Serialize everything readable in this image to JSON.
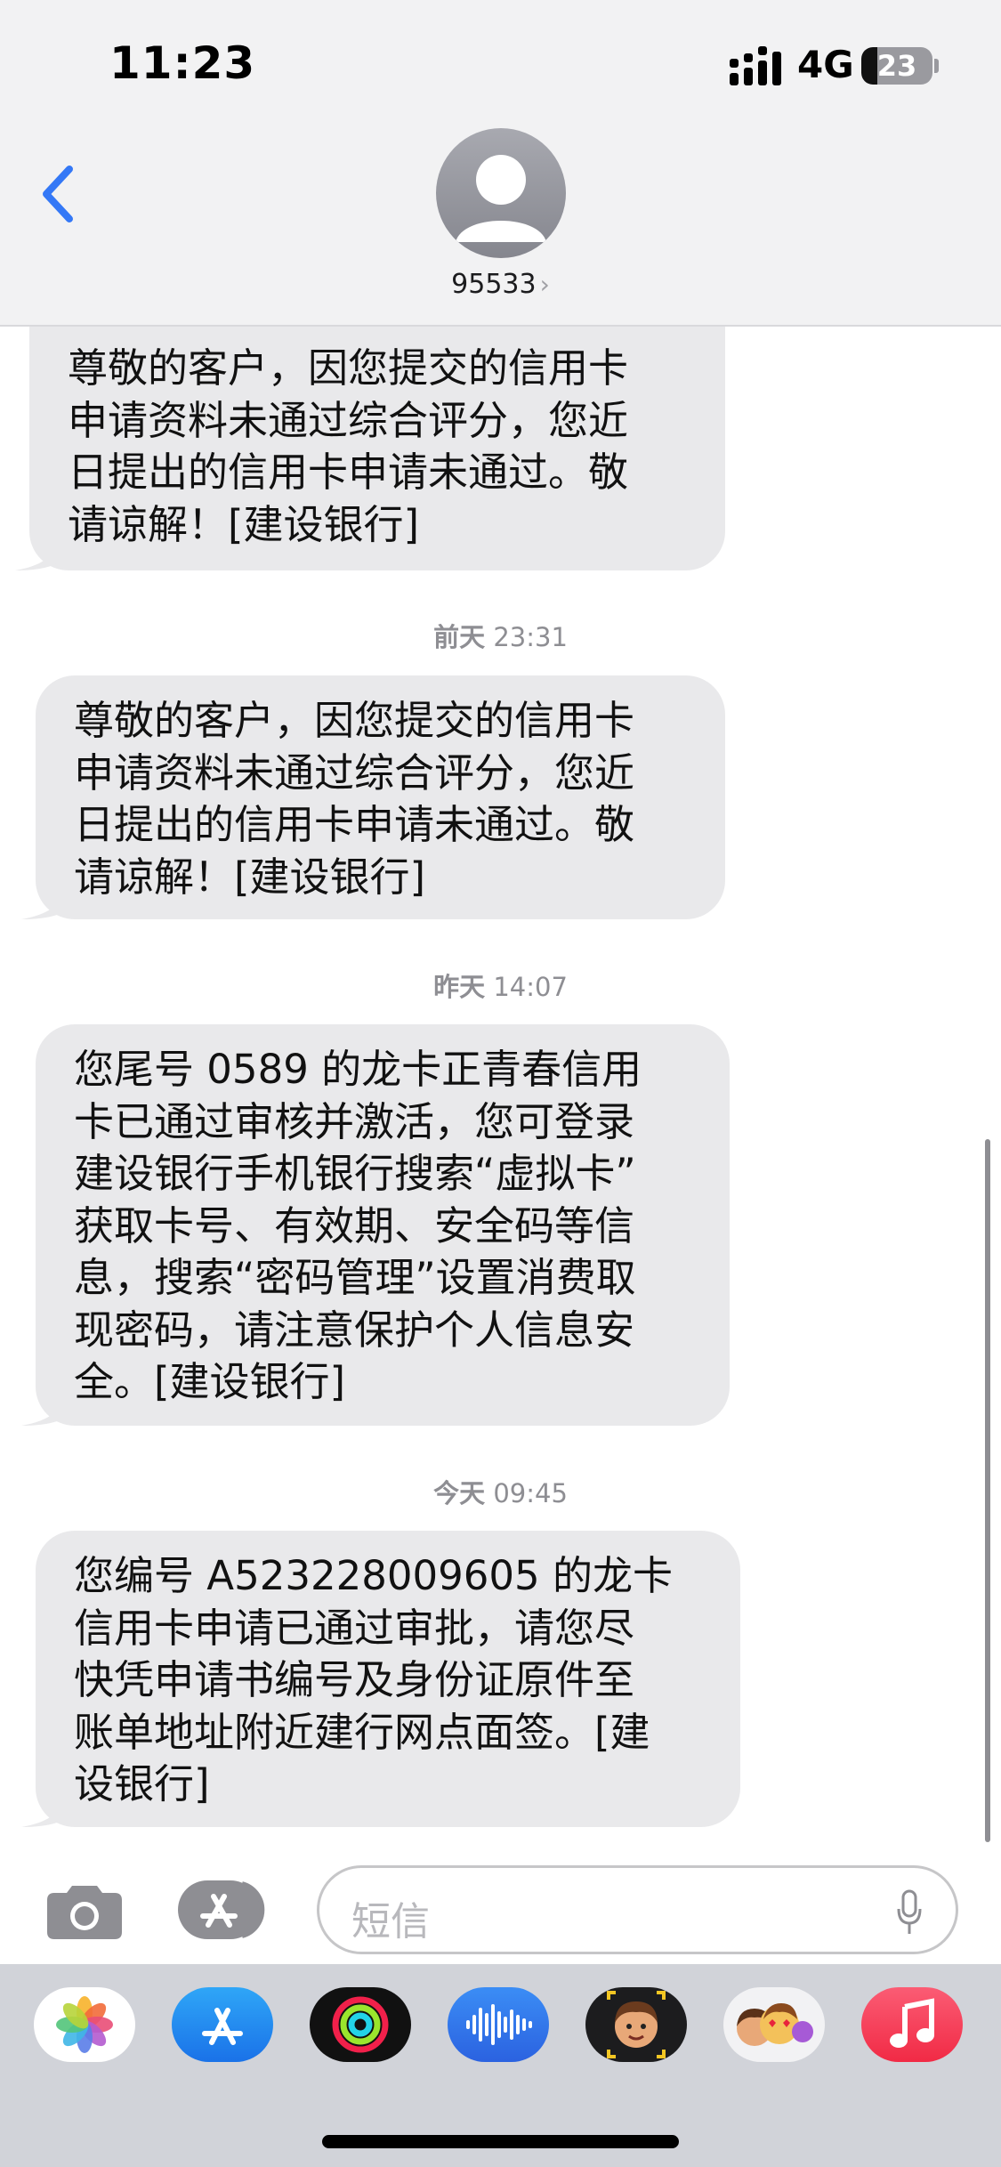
{
  "status_bar": {
    "time": "11:23",
    "network": "4G",
    "battery_level": "23",
    "battery_fraction": 0.23
  },
  "header": {
    "contact_name": "95533",
    "back_icon": "chevron-left-icon",
    "avatar_icon": "person-silhouette-icon",
    "accent_color": "#3478f6"
  },
  "messages": [
    {
      "text": "尊敬的客户，因您提交的信用卡\n申请资料未通过综合评分，您近\n日提出的信用卡申请未通过。敬\n请谅解！[建设银行]"
    },
    {
      "timestamp_day": "前天",
      "timestamp_time": "23:31",
      "text": "尊敬的客户，因您提交的信用卡\n申请资料未通过综合评分，您近\n日提出的信用卡申请未通过。敬\n请谅解！[建设银行]"
    },
    {
      "timestamp_day": "昨天",
      "timestamp_time": "14:07",
      "text": "您尾号 0589 的龙卡正青春信用\n卡已通过审核并激活，您可登录\n建设银行手机银行搜索“虚拟卡”\n获取卡号、有效期、安全码等信\n息，搜索“密码管理”设置消费取\n现密码，请注意保护个人信息安\n全。[建设银行]"
    },
    {
      "timestamp_day": "今天",
      "timestamp_time": "09:45",
      "text": "您编号 A523228009605 的龙卡\n信用卡申请已通过审批，请您尽\n快凭申请书编号及身份证原件至\n账单地址附近建行网点面签。[建\n设银行]"
    }
  ],
  "input": {
    "placeholder": "短信",
    "camera_icon": "camera-icon",
    "apps_icon": "app-store-icon",
    "mic_icon": "microphone-icon"
  },
  "app_drawer": [
    {
      "name": "photos-app-icon"
    },
    {
      "name": "app-store-app-icon"
    },
    {
      "name": "activity-app-icon"
    },
    {
      "name": "audio-messages-app-icon"
    },
    {
      "name": "memoji-app-icon"
    },
    {
      "name": "memoji-stickers-app-icon"
    },
    {
      "name": "music-app-icon"
    }
  ]
}
